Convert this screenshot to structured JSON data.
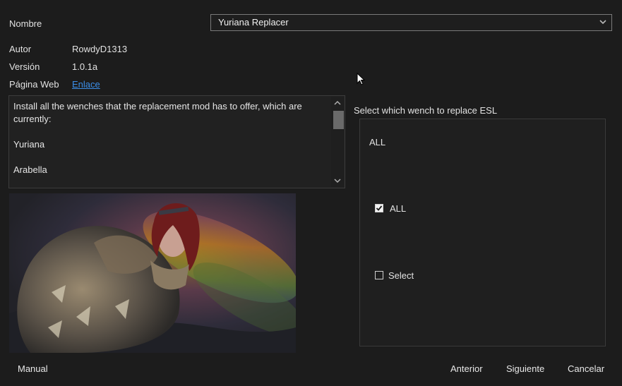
{
  "fields": {
    "name_label": "Nombre",
    "name_value": "Yuriana Replacer",
    "author_label": "Autor",
    "author_value": "RowdyD1313",
    "version_label": "Versión",
    "version_value": "1.0.1a",
    "web_label": "Página Web",
    "web_link": "Enlace"
  },
  "description": {
    "lines": [
      "Install all the wenches that the replacement mod has to offer, which are currently:",
      "Yuriana",
      "Arabella"
    ]
  },
  "options": {
    "group_label": "Select which wench to replace ESL",
    "group_title": "ALL",
    "items": [
      {
        "label": "ALL",
        "checked": true
      },
      {
        "label": "Select",
        "checked": false
      }
    ]
  },
  "footer": {
    "manual": "Manual",
    "previous": "Anterior",
    "next": "Siguiente",
    "cancel": "Cancelar"
  },
  "icons": {
    "dropdown": "chevron-down-icon",
    "scroll_up": "chevron-up-icon",
    "scroll_down": "chevron-down-icon",
    "check": "checkmark-icon"
  },
  "colors": {
    "background": "#1c1c1c",
    "link": "#3b8ee8",
    "border": "#7a7a7a"
  }
}
